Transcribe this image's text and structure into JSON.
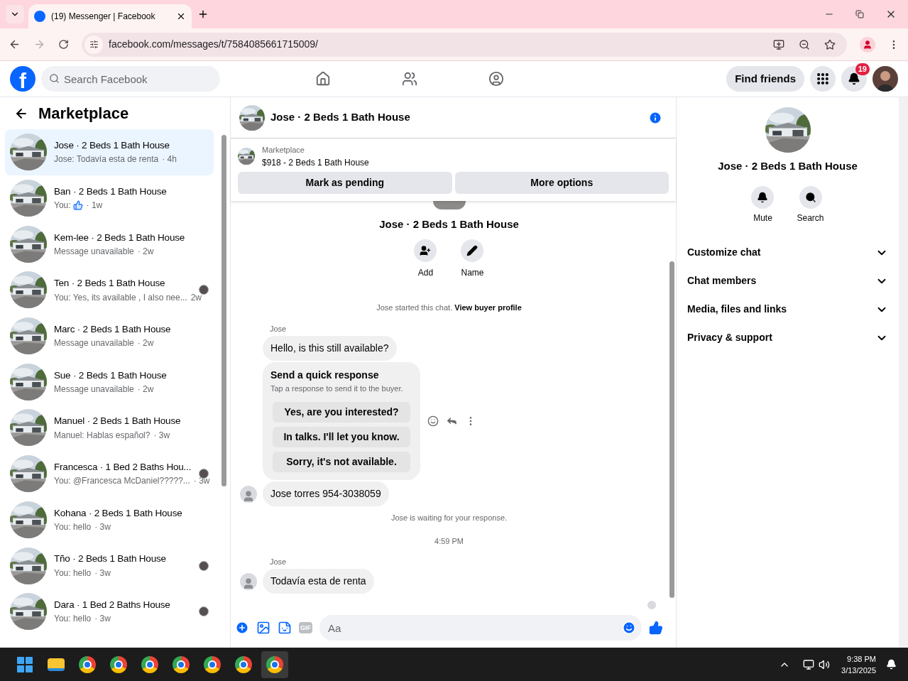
{
  "browser": {
    "tab_title": "(19) Messenger | Facebook",
    "url": "facebook.com/messages/t/7584085661715009/"
  },
  "header": {
    "logo": "f",
    "search_placeholder": "Search Facebook",
    "nav": [
      {
        "kind": "home",
        "selected": false
      },
      {
        "kind": "friends",
        "selected": false
      },
      {
        "kind": "groups",
        "selected": false
      }
    ],
    "find_friends": "Find friends",
    "notification_count": "19"
  },
  "sidebar": {
    "title": "Marketplace",
    "conversations": [
      {
        "title": "Jose · 2 Beds 1 Bath House",
        "preview": "Jose: Todavía esta de renta",
        "like": false,
        "time": "· 4h",
        "seen": false,
        "selected": true
      },
      {
        "title": "Ban · 2 Beds 1 Bath House",
        "preview": "You:",
        "like": true,
        "time": "· 1w",
        "seen": false,
        "selected": false
      },
      {
        "title": "Kem-lee · 2 Beds 1 Bath House",
        "preview": "Message unavailable",
        "like": false,
        "time": "· 2w",
        "seen": false,
        "selected": false
      },
      {
        "title": "Ten · 2 Beds 1 Bath House",
        "preview": "You: Yes, its available , I also nee...",
        "like": false,
        "time": "2w",
        "seen": true,
        "selected": false
      },
      {
        "title": "Marc · 2 Beds 1 Bath House",
        "preview": "Message unavailable",
        "like": false,
        "time": "· 2w",
        "seen": false,
        "selected": false
      },
      {
        "title": "Sue · 2 Beds 1 Bath House",
        "preview": "Message unavailable",
        "like": false,
        "time": "· 2w",
        "seen": false,
        "selected": false
      },
      {
        "title": "Manuel · 2 Beds 1 Bath House",
        "preview": "Manuel: Hablas español?",
        "like": false,
        "time": "· 3w",
        "seen": false,
        "selected": false
      },
      {
        "title": "Francesca · 1 Bed 2 Baths Hou...",
        "preview": "You: @Francesca McDaniel?????...",
        "like": false,
        "time": "· 3w",
        "seen": true,
        "selected": false
      },
      {
        "title": "Kohana · 2 Beds 1 Bath House",
        "preview": "You: hello",
        "like": false,
        "time": "· 3w",
        "seen": false,
        "selected": false
      },
      {
        "title": "Tño · 2 Beds 1 Bath House",
        "preview": "You: hello",
        "like": false,
        "time": "· 3w",
        "seen": true,
        "selected": false
      },
      {
        "title": "Dara · 1 Bed 2 Baths House",
        "preview": "You: hello",
        "like": false,
        "time": "· 3w",
        "seen": true,
        "selected": false
      }
    ]
  },
  "chat": {
    "title": "Jose · 2 Beds 1 Bath House",
    "listing": {
      "label": "Marketplace",
      "price_title": "$918 - 2 Beds 1 Bath House"
    },
    "actions": [
      "Mark as pending",
      "More options"
    ],
    "intro": {
      "title": "Jose · 2 Beds 1 Bath House",
      "buttons": [
        {
          "kind": "add",
          "label": "Add"
        },
        {
          "kind": "name",
          "label": "Name"
        }
      ]
    },
    "messages": [
      {
        "kind": "system",
        "text": "Jose started this chat.",
        "link": "View buyer profile"
      },
      {
        "kind": "sender",
        "text": "Jose"
      },
      {
        "kind": "bubble",
        "text": "Hello, is this still available?",
        "avatar": false
      },
      {
        "kind": "quick",
        "title": "Send a quick response",
        "hint": "Tap a response to send it to the buyer.",
        "options": [
          "Yes, are you interested?",
          "In talks. I'll let you know.",
          "Sorry, it's not available."
        ]
      },
      {
        "kind": "bubble",
        "text": "Jose torres 954-3038059",
        "avatar": true
      },
      {
        "kind": "system",
        "text": "Jose is waiting for your response."
      },
      {
        "kind": "time",
        "text": "4:59 PM"
      },
      {
        "kind": "sender",
        "text": "Jose"
      },
      {
        "kind": "bubble",
        "text": "Todavía esta de renta",
        "avatar": true
      }
    ],
    "composer": {
      "gif": "GIF",
      "placeholder": "Aa"
    }
  },
  "details": {
    "title": "Jose · 2 Beds 1 Bath House",
    "buttons": [
      {
        "kind": "mute",
        "label": "Mute"
      },
      {
        "kind": "search",
        "label": "Search"
      }
    ],
    "sections": [
      {
        "label": "Customize chat",
        "expanded": false
      },
      {
        "label": "Chat members",
        "expanded": false
      },
      {
        "label": "Media, files and links",
        "expanded": false
      },
      {
        "label": "Privacy & support",
        "expanded": false
      }
    ]
  },
  "taskbar": {
    "apps": [
      {
        "kind": "start",
        "selected": false
      },
      {
        "kind": "folder",
        "selected": false
      },
      {
        "kind": "chrome",
        "selected": false
      },
      {
        "kind": "chrome",
        "selected": false
      },
      {
        "kind": "chrome",
        "selected": false
      },
      {
        "kind": "chrome",
        "selected": false
      },
      {
        "kind": "chrome",
        "selected": false
      },
      {
        "kind": "chrome",
        "selected": false
      },
      {
        "kind": "chrome",
        "selected": true
      }
    ],
    "time": "9:38 PM",
    "date": "3/13/2025"
  }
}
